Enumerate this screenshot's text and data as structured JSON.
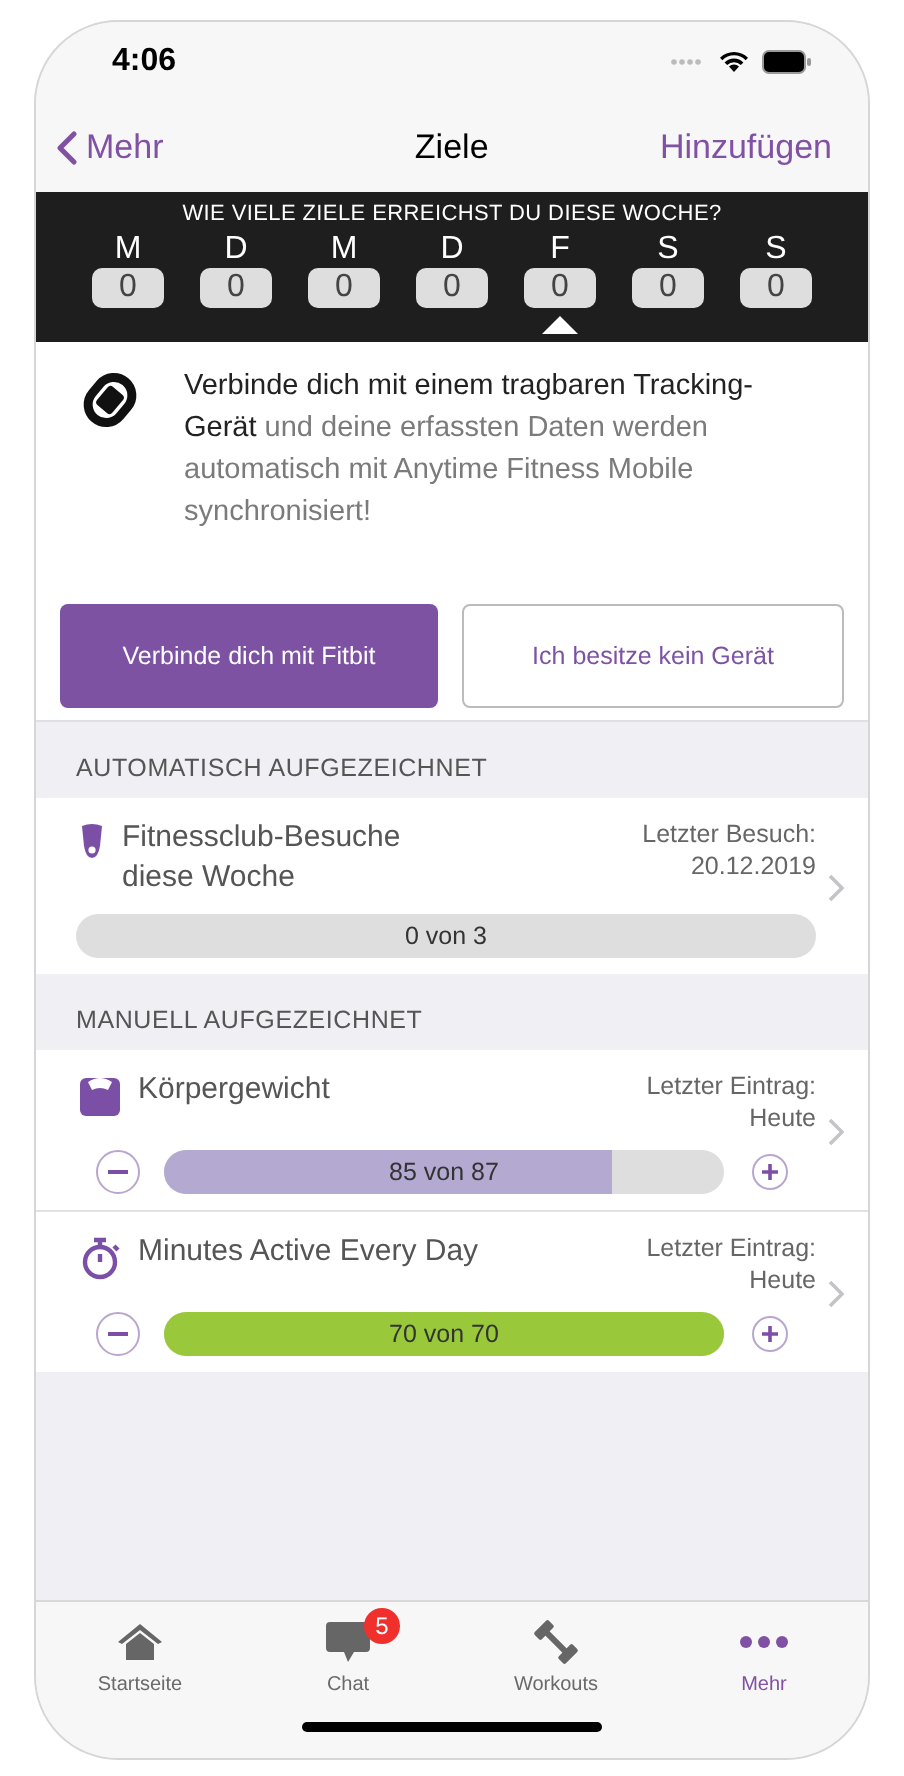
{
  "status_bar": {
    "time": "4:06"
  },
  "nav": {
    "back": "Mehr",
    "title": "Ziele",
    "action": "Hinzufügen"
  },
  "week": {
    "question": "WIE VIELE ZIELE ERREICHST DU DIESE WOCHE?",
    "days": [
      {
        "label": "M",
        "count": "0",
        "selected": false
      },
      {
        "label": "D",
        "count": "0",
        "selected": false
      },
      {
        "label": "M",
        "count": "0",
        "selected": false
      },
      {
        "label": "D",
        "count": "0",
        "selected": false
      },
      {
        "label": "F",
        "count": "0",
        "selected": true
      },
      {
        "label": "S",
        "count": "0",
        "selected": false
      },
      {
        "label": "S",
        "count": "0",
        "selected": false
      }
    ]
  },
  "connect": {
    "text": "**Verbinde dich mit einem tragbaren Tracking-Gerät** und deine erfassten Daten werden automatisch mit Anytime Fitness Mobile synchronisiert!",
    "primary_button": "Verbinde dich mit Fitbit",
    "secondary_button": "Ich besitze kein Gerät"
  },
  "sections": [
    {
      "header": "AUTOMATISCH AUFGEZEICHNET",
      "goals": [
        {
          "kind": "auto",
          "title": "Fitnessclub-Besuche diese Woche",
          "last_label": "Letzter Besuch:",
          "last_value": "20.12.2019",
          "progress": "0 von 3",
          "level": 0
        }
      ]
    },
    {
      "header": "MANUELL AUFGEZEICHNET",
      "goals": [
        {
          "kind": "manual",
          "title": "Körpergewicht",
          "last_label": "Letzter Eintrag:",
          "last_value": "Heute",
          "progress": "85 von 87",
          "level": 0.8,
          "color": "#b4a9d1"
        },
        {
          "kind": "manual",
          "title": "Minutes Active Every Day",
          "last_label": "Letzter Eintrag:",
          "last_value": "Heute",
          "progress": "70 von 70",
          "level": 1,
          "color": "#99c93a"
        }
      ]
    }
  ],
  "tab_bar": [
    {
      "label": "Startseite",
      "selected": false
    },
    {
      "label": "Chat",
      "badge": "5",
      "selected": false
    },
    {
      "label": "Workouts",
      "selected": false
    },
    {
      "label": "Mehr",
      "selected": true
    }
  ]
}
